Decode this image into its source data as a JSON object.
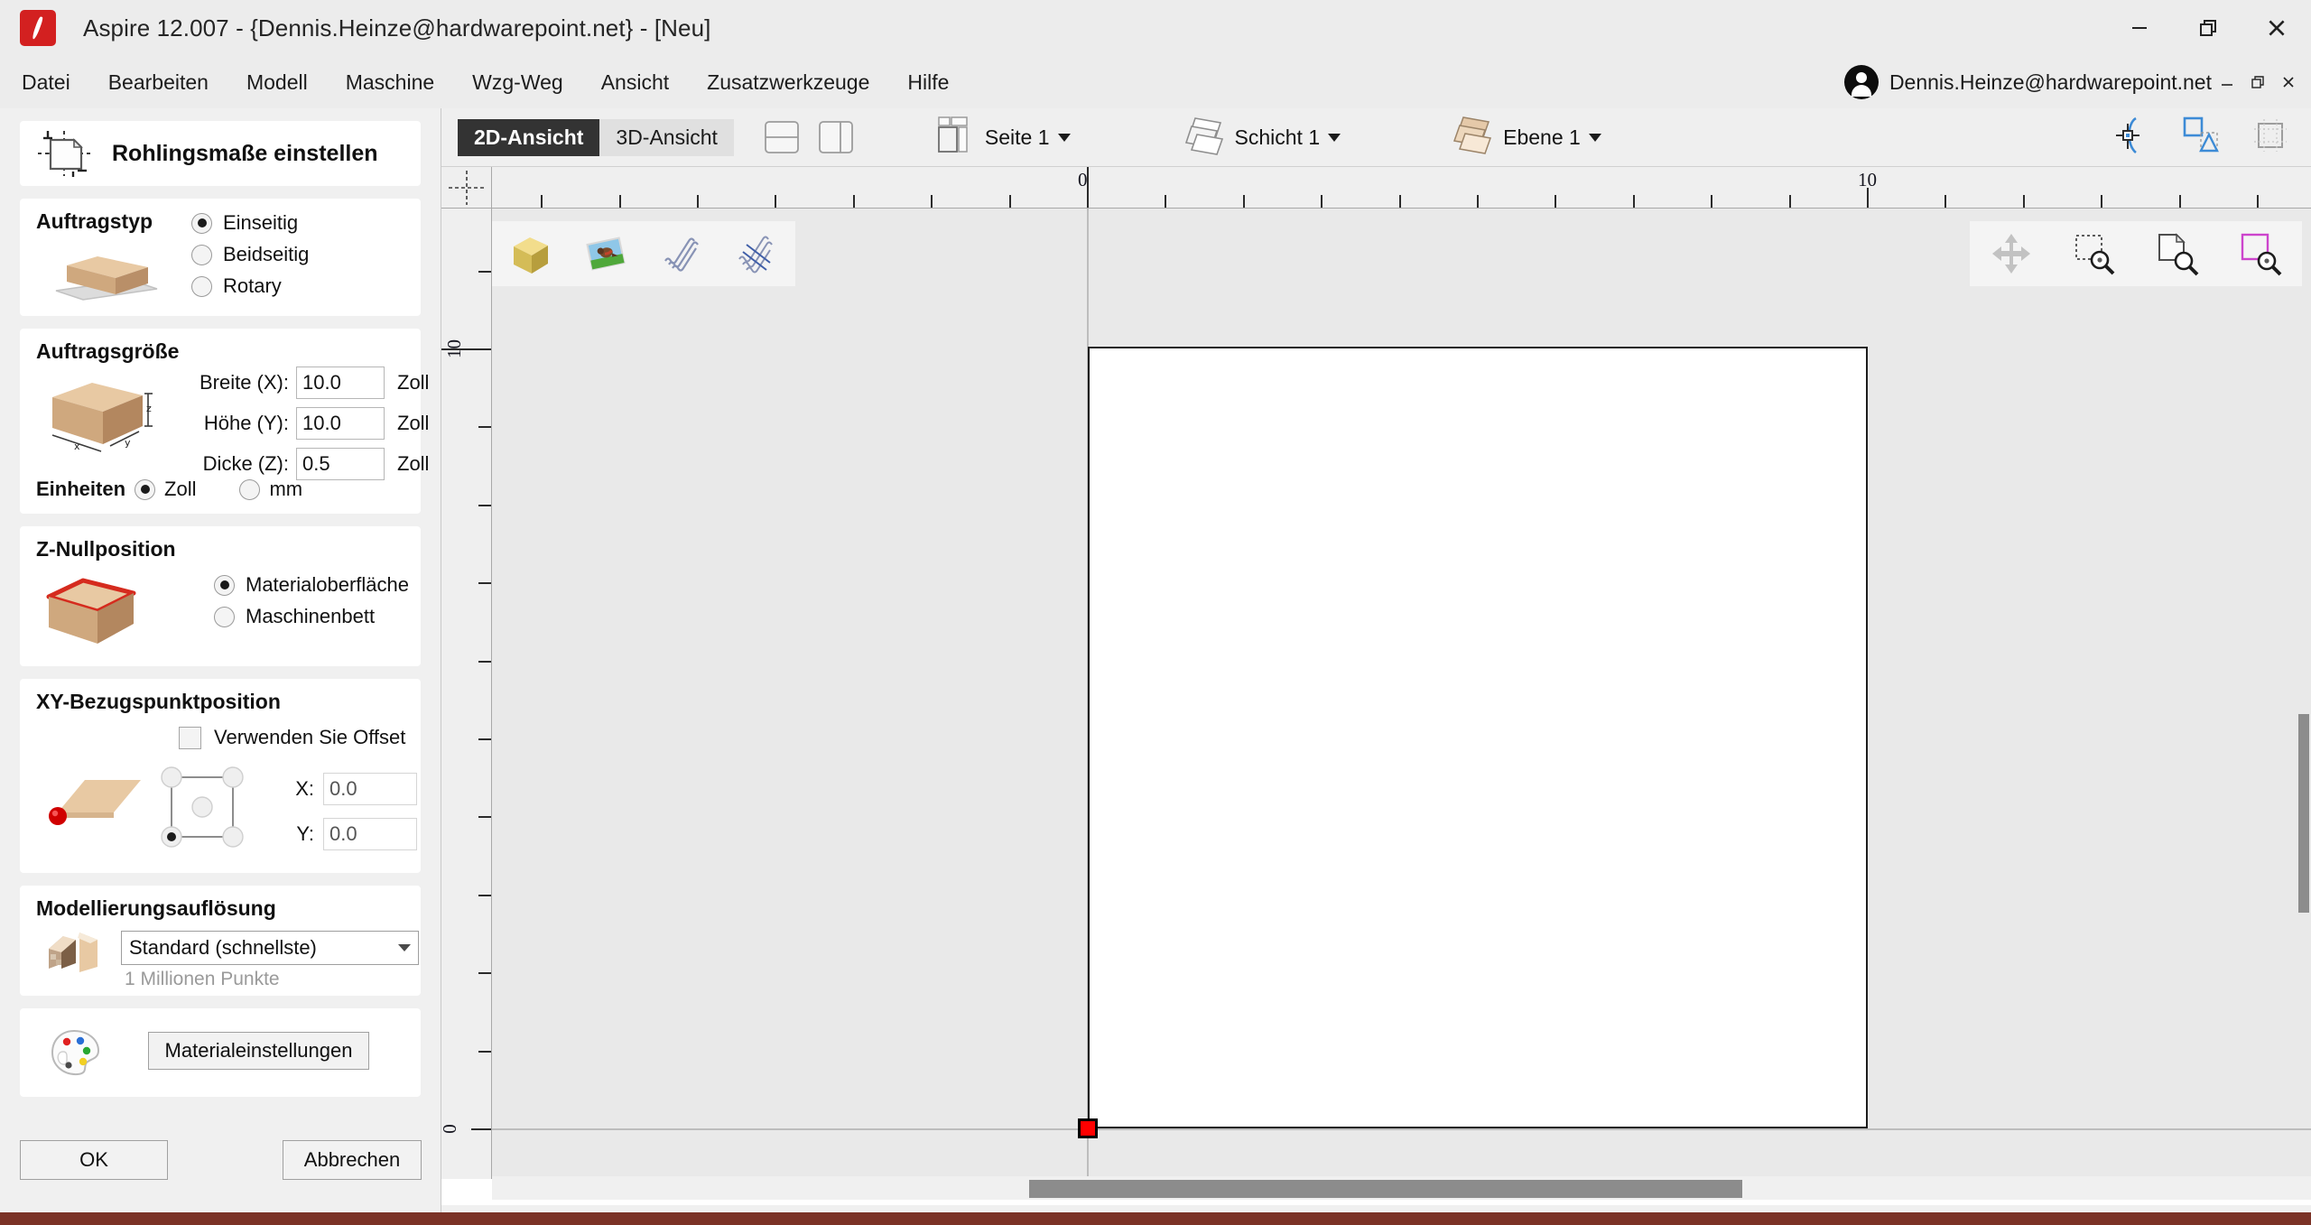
{
  "window": {
    "title": "Aspire 12.007 - {Dennis.Heinze@hardwarepoint.net} - [Neu]",
    "logo_icon": "aspire-logo-icon",
    "minimize_icon": "minimize-icon",
    "maximize_icon": "restore-icon",
    "close_icon": "close-icon"
  },
  "menubar": {
    "items": [
      {
        "label": "Datei"
      },
      {
        "label": "Bearbeiten"
      },
      {
        "label": "Modell"
      },
      {
        "label": "Maschine"
      },
      {
        "label": "Wzg-Weg"
      },
      {
        "label": "Ansicht"
      },
      {
        "label": "Zusatzwerkzeuge"
      },
      {
        "label": "Hilfe"
      }
    ]
  },
  "account": {
    "avatar_icon": "user-avatar-icon",
    "name": "Dennis.Heinze@hardwarepoint.net",
    "minimize_icon": "minimize-icon",
    "restore_icon": "restore-icon",
    "close_icon": "close-icon"
  },
  "dialog": {
    "header": {
      "icon": "material-setup-icon",
      "title": "Rohlingsmaße einstellen"
    },
    "job_type": {
      "title": "Auftragstyp",
      "icon": "single-sided-block-icon",
      "options": [
        {
          "label": "Einseitig",
          "selected": true
        },
        {
          "label": "Beidseitig",
          "selected": false
        },
        {
          "label": "Rotary",
          "selected": false
        }
      ]
    },
    "job_size": {
      "title": "Auftragsgröße",
      "icon": "block-xyz-icon",
      "fields": [
        {
          "label": "Breite (X):",
          "value": "10.0",
          "unit": "Zoll"
        },
        {
          "label": "Höhe (Y):",
          "value": "10.0",
          "unit": "Zoll"
        },
        {
          "label": "Dicke (Z):",
          "value": "0.5",
          "unit": "Zoll"
        }
      ],
      "units_label": "Einheiten",
      "units": [
        {
          "label": "Zoll",
          "selected": true
        },
        {
          "label": "mm",
          "selected": false
        }
      ]
    },
    "z_zero": {
      "title": "Z-Nullposition",
      "icon": "z-zero-top-icon",
      "options": [
        {
          "label": "Materialoberfläche",
          "selected": true
        },
        {
          "label": "Maschinenbett",
          "selected": false
        }
      ]
    },
    "xy_datum": {
      "title": "XY-Bezugspunktposition",
      "icon": "xy-datum-plane-icon",
      "use_offset": {
        "label": "Verwenden Sie Offset",
        "checked": false
      },
      "selected_corner": "bottom-left",
      "x": {
        "label": "X:",
        "value": "0.0"
      },
      "y": {
        "label": "Y:",
        "value": "0.0"
      }
    },
    "modeling_resolution": {
      "title": "Modellierungsauflösung",
      "icon": "resolution-icon",
      "selected": "Standard (schnellste)",
      "hint": "1 Millionen Punkte"
    },
    "material": {
      "icon": "palette-icon",
      "button_label": "Materialeinstellungen"
    },
    "actions": {
      "ok_label": "OK",
      "cancel_label": "Abbrechen"
    }
  },
  "view_toolbar": {
    "tab_2d": "2D-Ansicht",
    "tab_3d": "3D-Ansicht",
    "split_horizontal_icon": "split-horizontal-icon",
    "split_vertical_icon": "split-vertical-icon",
    "page": {
      "icon": "page-icon",
      "label": "Seite 1"
    },
    "sheet": {
      "icon": "sheet-icon",
      "label": "Schicht 1"
    },
    "layer": {
      "icon": "layer-icon",
      "label": "Ebene 1"
    },
    "right_icons": [
      {
        "name": "snap-node-icon"
      },
      {
        "name": "snap-geometry-icon"
      },
      {
        "name": "snap-grid-icon"
      }
    ]
  },
  "canvas": {
    "left_tools": [
      {
        "name": "3d-model-icon"
      },
      {
        "name": "bitmap-image-icon"
      },
      {
        "name": "toolpath-preview-icon"
      },
      {
        "name": "toolpath-multiple-icon"
      }
    ],
    "right_tools": [
      {
        "name": "pan-icon"
      },
      {
        "name": "zoom-selection-icon"
      },
      {
        "name": "zoom-drawing-icon"
      },
      {
        "name": "zoom-job-icon"
      }
    ],
    "ruler_units": "Zoll",
    "ruler_h_labels": [
      {
        "value": "0",
        "pos": 0
      },
      {
        "value": "10",
        "pos": 10
      }
    ],
    "ruler_v_labels": [
      {
        "value": "0",
        "pos": 0
      },
      {
        "value": "10",
        "pos": 10
      }
    ],
    "origin_marker": "xy-origin-marker",
    "material_width_in": 10,
    "material_height_in": 10
  },
  "colors": {
    "accent_red": "#d32020",
    "tab_active_bg": "#333333",
    "origin_red": "#ff0000",
    "status_strip": "#7b3226",
    "panel_bg": "#f0f0f0",
    "chrome_bg": "#ececec"
  }
}
